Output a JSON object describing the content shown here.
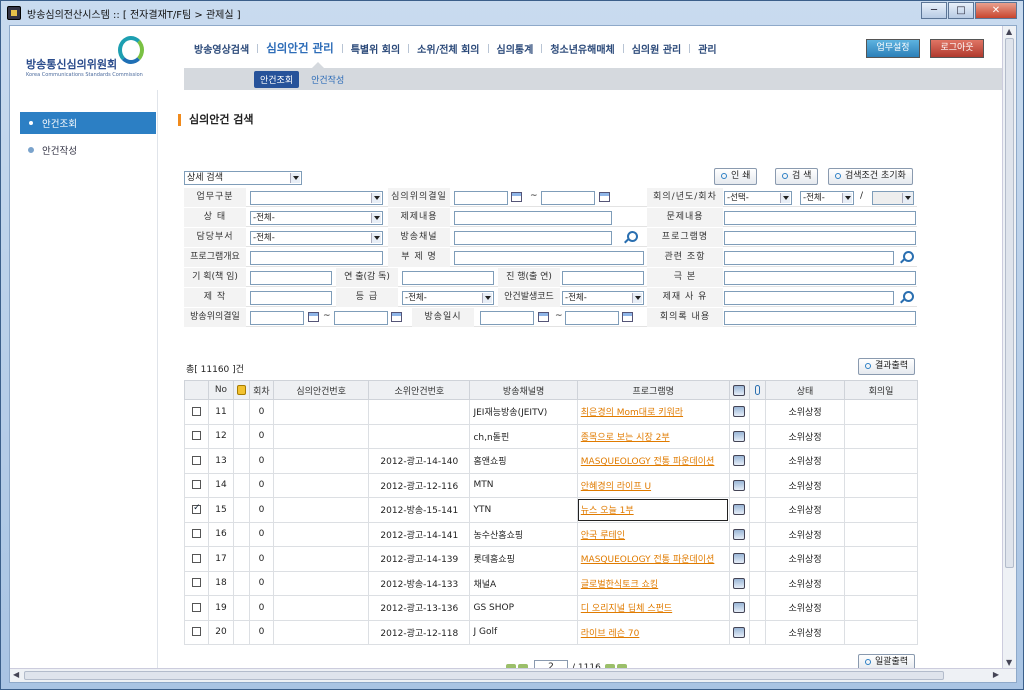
{
  "window": {
    "title": "방송심의전산시스템 :: [ 전자결재T/F팀 > 관제실 ]"
  },
  "logo": {
    "name": "방송통신심의위원회",
    "sub": "Korea Communications Standards Commission"
  },
  "gnb": [
    "방송영상검색",
    "심의안건 관리",
    "특별위 회의",
    "소위/전체 회의",
    "심의통계",
    "청소년유해매체",
    "심의원 관리",
    "관리"
  ],
  "header": {
    "work_btn": "업무설정",
    "logout_btn": "로그아웃"
  },
  "subnav": [
    "안건조회",
    "안건작성"
  ],
  "lnb": [
    "안건조회",
    "안건작성"
  ],
  "page_title": "심의안건 검색",
  "search": {
    "mode": "상세 검색",
    "print": "인 쇄",
    "search": "검 색",
    "reset": "검색조건 초기화",
    "labels": {
      "biz": "업무구분",
      "meet_date": "심의위의결일",
      "meet_year": "회의/년도/회차",
      "status": "상 태",
      "title": "제제내용",
      "problem": "문제내용",
      "dept": "담당부서",
      "channel": "방송채널",
      "program": "프로그램명",
      "summary": "프로그램개요",
      "subtitle": "부 제 명",
      "related": "관련 조항",
      "planner": "기 획(책 임)",
      "director": "연 출(감 독)",
      "host": "진 행(출 연)",
      "writer": "극 본",
      "producer": "제 작",
      "grade": "등 급",
      "source": "안건발생코드",
      "reason": "제재 사 유",
      "bdate": "방송위의결일",
      "airdate": "방송일시",
      "minutes": "회의록 내용"
    },
    "values": {
      "select": "-선택-",
      "all": "-전체-",
      "slash": "/",
      "tilde": "~"
    }
  },
  "total": "총[    11160 ]건",
  "result_btn": "결과출력",
  "bulk_btn": "일괄출력",
  "columns": {
    "no": "No",
    "round": "회차",
    "agenda": "심의안건번호",
    "sub_agenda": "소위안건번호",
    "channel": "방송채널명",
    "program": "프로그램명",
    "status": "상태",
    "meeting": "회의일"
  },
  "rows": [
    {
      "checked": false,
      "no": "11",
      "round": "0",
      "agenda": "",
      "sub": "",
      "channel": "JEI재능방송(JEITV)",
      "program": "최은경의 Mom대로 키워라",
      "status": "소위상정",
      "meeting": ""
    },
    {
      "checked": false,
      "no": "12",
      "round": "0",
      "agenda": "",
      "sub": "",
      "channel": "ch,n돌핀",
      "program": "종목으로 보는 시장 2부",
      "status": "소위상정",
      "meeting": ""
    },
    {
      "checked": false,
      "no": "13",
      "round": "0",
      "agenda": "",
      "sub": "2012-광고-14-140",
      "channel": "홈앤쇼핑",
      "program": "MASQUEOLOGY 전통 파운데이션",
      "status": "소위상정",
      "meeting": ""
    },
    {
      "checked": false,
      "no": "14",
      "round": "0",
      "agenda": "",
      "sub": "2012-광고-12-116",
      "channel": "MTN",
      "program": "안혜경의 라이프 U",
      "status": "소위상정",
      "meeting": ""
    },
    {
      "checked": true,
      "no": "15",
      "round": "0",
      "agenda": "",
      "sub": "2012-방송-15-141",
      "channel": "YTN",
      "program": "뉴스 오늘 1부",
      "status": "소위상정",
      "meeting": ""
    },
    {
      "checked": false,
      "no": "16",
      "round": "0",
      "agenda": "",
      "sub": "2012-광고-14-141",
      "channel": "농수산홈쇼핑",
      "program": "안국 루테인",
      "status": "소위상정",
      "meeting": ""
    },
    {
      "checked": false,
      "no": "17",
      "round": "0",
      "agenda": "",
      "sub": "2012-광고-14-139",
      "channel": "롯데홈쇼핑",
      "program": "MASQUEOLOGY 전통 파운데이션",
      "status": "소위상정",
      "meeting": ""
    },
    {
      "checked": false,
      "no": "18",
      "round": "0",
      "agenda": "",
      "sub": "2012-방송-14-133",
      "channel": "채널A",
      "program": "글로벌한식토크 쇼킹",
      "status": "소위상정",
      "meeting": ""
    },
    {
      "checked": false,
      "no": "19",
      "round": "0",
      "agenda": "",
      "sub": "2012-광고-13-136",
      "channel": "GS SHOP",
      "program": "디 오리지널 딥체 스펀드",
      "status": "소위상정",
      "meeting": ""
    },
    {
      "checked": false,
      "no": "20",
      "round": "0",
      "agenda": "",
      "sub": "2012-광고-12-118",
      "channel": "J Golf",
      "program": "라이브 레슨 70",
      "status": "소위상정",
      "meeting": ""
    }
  ],
  "pager": {
    "page": "2",
    "total": "/ 1116"
  }
}
